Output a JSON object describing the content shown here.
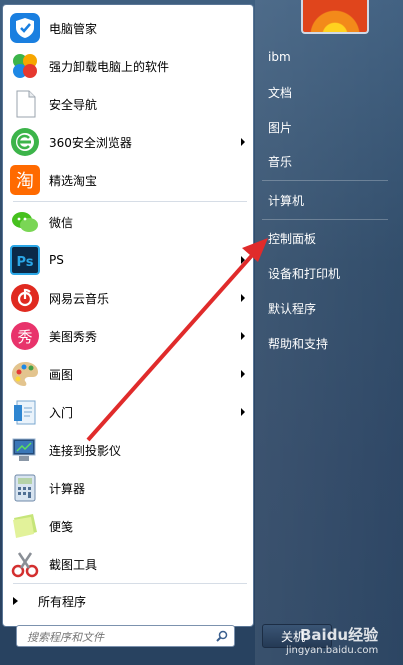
{
  "menu": {
    "items": [
      {
        "label": "电脑管家",
        "icon": "tencent-pc-manager-icon",
        "arrow": false
      },
      {
        "label": "强力卸载电脑上的软件",
        "icon": "uninstall-clover-icon",
        "arrow": false
      },
      {
        "label": "安全导航",
        "icon": "blank-document-icon",
        "arrow": false
      },
      {
        "label": "360安全浏览器",
        "icon": "360-browser-icon",
        "arrow": true
      },
      {
        "label": "精选淘宝",
        "icon": "taobao-icon",
        "arrow": false
      },
      {
        "label": "微信",
        "icon": "wechat-icon",
        "arrow": false
      },
      {
        "label": "PS",
        "icon": "photoshop-icon",
        "arrow": true
      },
      {
        "label": "网易云音乐",
        "icon": "netease-music-icon",
        "arrow": true
      },
      {
        "label": "美图秀秀",
        "icon": "meitu-icon",
        "arrow": true
      },
      {
        "label": "画图",
        "icon": "paint-palette-icon",
        "arrow": true
      },
      {
        "label": "入门",
        "icon": "getting-started-icon",
        "arrow": true
      },
      {
        "label": "连接到投影仪",
        "icon": "projector-icon",
        "arrow": false
      },
      {
        "label": "计算器",
        "icon": "calculator-icon",
        "arrow": false
      },
      {
        "label": "便笺",
        "icon": "sticky-note-icon",
        "arrow": false
      },
      {
        "label": "截图工具",
        "icon": "snipping-tool-icon",
        "arrow": false
      }
    ],
    "all_programs": "所有程序",
    "search_placeholder": "搜索程序和文件"
  },
  "right": {
    "items": [
      "ibm",
      "文档",
      "图片",
      "音乐",
      "计算机",
      "控制面板",
      "设备和打印机",
      "默认程序",
      "帮助和支持"
    ],
    "shutdown": "关机"
  },
  "watermark": {
    "brand": "Baidu经验",
    "url": "jingyan.baidu.com"
  }
}
